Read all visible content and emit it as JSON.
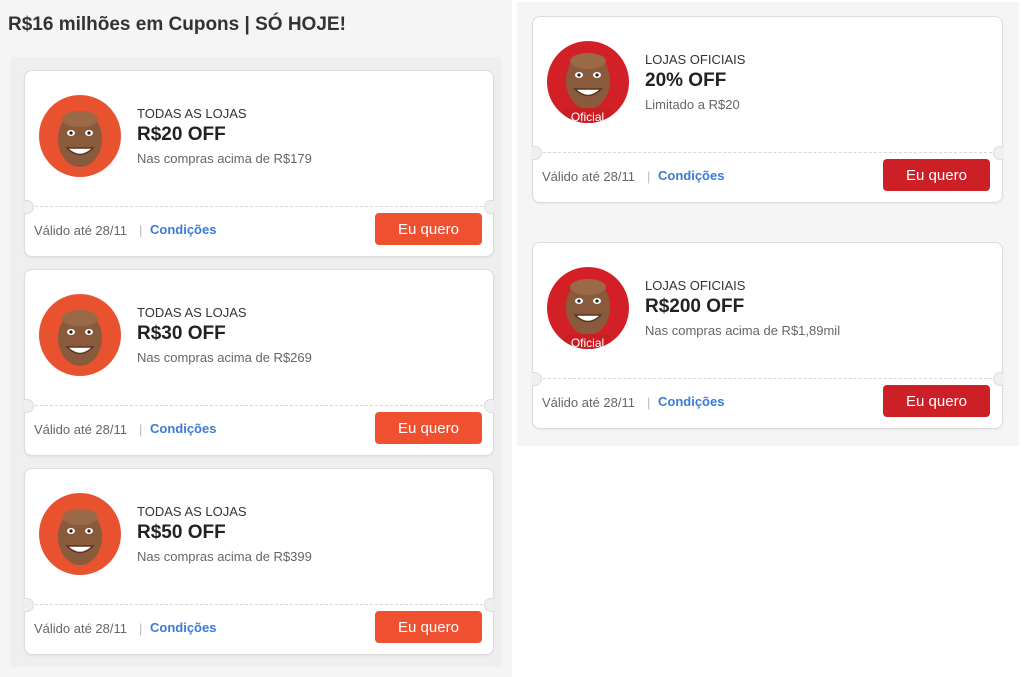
{
  "header": {
    "title": "R$16 milhões em Cupons | SÓ HOJE!"
  },
  "colors": {
    "accent_orange": "#ef5030",
    "accent_red": "#cc1f26",
    "link_blue": "#3a7bd5"
  },
  "left_coupons": [
    {
      "scope": "TODAS AS LOJAS",
      "amount": "R$20 OFF",
      "condition": "Nas compras acima de R$179",
      "validity": "Válido até 28/11",
      "separator": "|",
      "conditions_link": "Condições",
      "cta": "Eu quero"
    },
    {
      "scope": "TODAS AS LOJAS",
      "amount": "R$30 OFF",
      "condition": "Nas compras acima de R$269",
      "validity": "Válido até 28/11",
      "separator": "|",
      "conditions_link": "Condições",
      "cta": "Eu quero"
    },
    {
      "scope": "TODAS AS LOJAS",
      "amount": "R$50 OFF",
      "condition": "Nas compras acima de R$399",
      "validity": "Válido até 28/11",
      "separator": "|",
      "conditions_link": "Condições",
      "cta": "Eu quero"
    }
  ],
  "right_coupons": [
    {
      "badge": "Oficial",
      "scope": "LOJAS OFICIAIS",
      "amount": "20% OFF",
      "condition": "Limitado a R$20",
      "validity": "Válido até 28/11",
      "separator": "|",
      "conditions_link": "Condições",
      "cta": "Eu quero"
    },
    {
      "badge": "Oficial",
      "scope": "LOJAS OFICIAIS",
      "amount": "R$200 OFF",
      "condition": "Nas compras acima de R$1,89mil",
      "validity": "Válido até 28/11",
      "separator": "|",
      "conditions_link": "Condições",
      "cta": "Eu quero"
    }
  ]
}
